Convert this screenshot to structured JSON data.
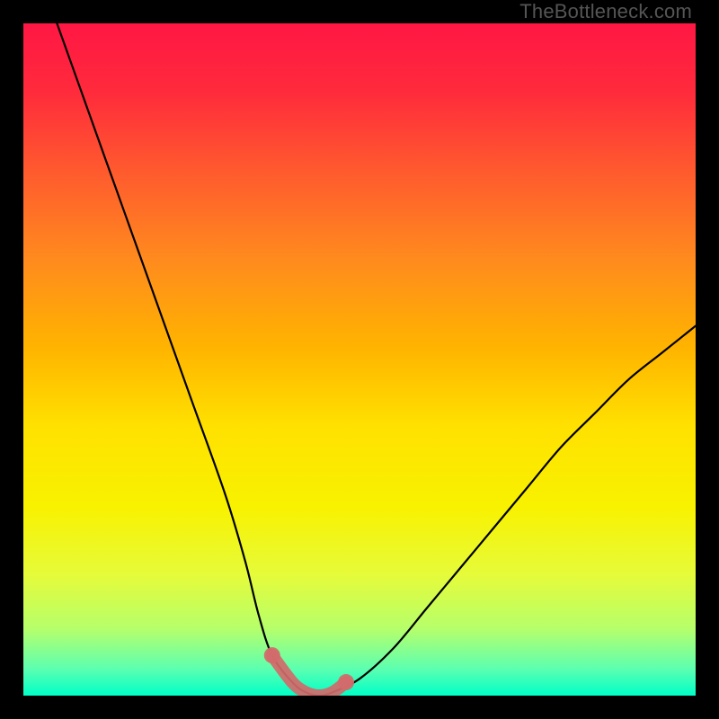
{
  "watermark": "TheBottleneck.com",
  "gradient": {
    "stops": [
      {
        "offset": 0.0,
        "color": "#ff1744"
      },
      {
        "offset": 0.1,
        "color": "#ff2a3c"
      },
      {
        "offset": 0.22,
        "color": "#ff5a2e"
      },
      {
        "offset": 0.35,
        "color": "#ff8a1e"
      },
      {
        "offset": 0.48,
        "color": "#ffb300"
      },
      {
        "offset": 0.6,
        "color": "#ffe100"
      },
      {
        "offset": 0.72,
        "color": "#f8f200"
      },
      {
        "offset": 0.82,
        "color": "#e6fb3a"
      },
      {
        "offset": 0.9,
        "color": "#b6ff6a"
      },
      {
        "offset": 0.96,
        "color": "#5dffb0"
      },
      {
        "offset": 1.0,
        "color": "#00ffc8"
      }
    ]
  },
  "chart_data": {
    "type": "line",
    "title": "",
    "xlabel": "",
    "ylabel": "",
    "xlim": [
      0,
      100
    ],
    "ylim": [
      0,
      100
    ],
    "series": [
      {
        "name": "bottleneck-curve",
        "x": [
          5,
          10,
          15,
          20,
          25,
          30,
          33,
          35,
          37,
          40,
          42,
          44,
          46,
          50,
          55,
          60,
          65,
          70,
          75,
          80,
          85,
          90,
          95,
          100
        ],
        "y": [
          100,
          86,
          72,
          58,
          44,
          30,
          20,
          12,
          6,
          2,
          0.5,
          0,
          0.5,
          2.5,
          7,
          13,
          19,
          25,
          31,
          37,
          42,
          47,
          51,
          55
        ]
      },
      {
        "name": "min-highlight",
        "x": [
          37,
          40,
          42,
          44,
          46,
          48
        ],
        "y": [
          6,
          2,
          0.5,
          0,
          0.5,
          2
        ]
      }
    ],
    "highlight_color": "#d36a6a",
    "curve_color": "#000000"
  }
}
